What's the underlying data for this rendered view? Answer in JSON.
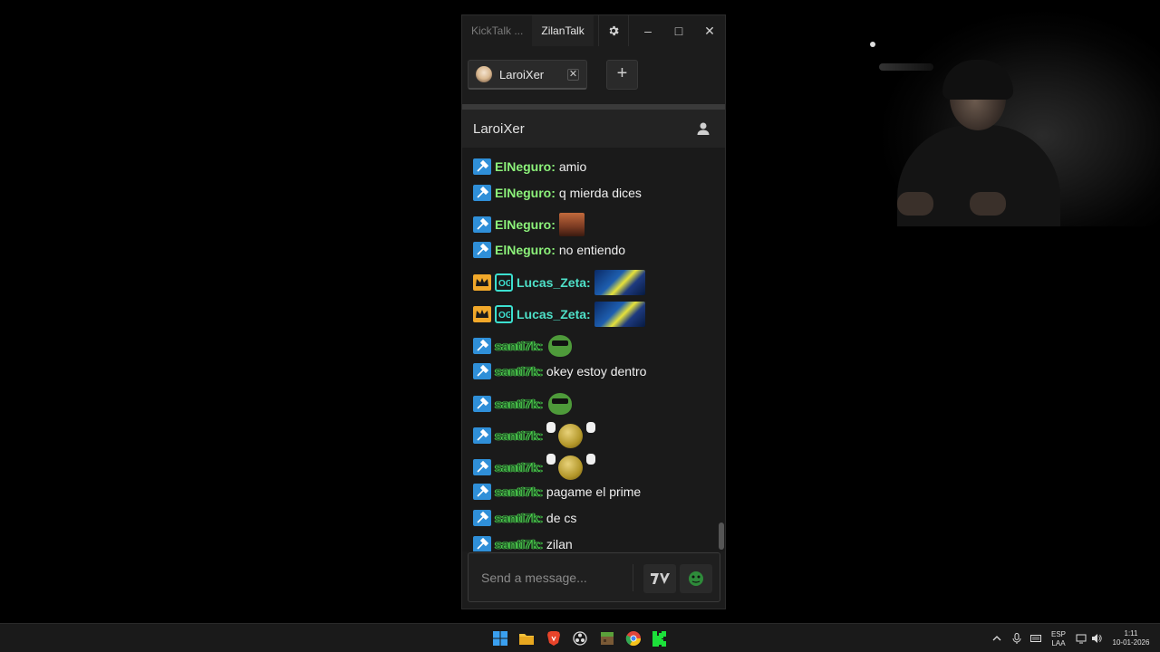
{
  "window": {
    "app_tabs": [
      "KickTalk ...",
      "ZilanTalk"
    ],
    "minimize": "–",
    "maximize": "□",
    "close": "✕"
  },
  "channel_tabs": [
    {
      "name": "LaroiXer",
      "close": "✕"
    }
  ],
  "add_tab": "+",
  "chat": {
    "title": "LaroiXer",
    "messages": [
      {
        "user": "ElNeguro:",
        "text": "amio",
        "badge": "mod-icon",
        "user_style": "green"
      },
      {
        "user": "ElNeguro:",
        "text": "q mierda dices",
        "badge": "mod-icon",
        "user_style": "green"
      },
      {
        "user": "ElNeguro:",
        "text": "",
        "emote": "face-emote",
        "badge": "mod-icon",
        "user_style": "green"
      },
      {
        "user": "ElNeguro:",
        "text": "no entiendo",
        "badge": "mod-icon",
        "user_style": "green"
      },
      {
        "user": "Lucas_Zeta:",
        "text": "",
        "emote": "car-emote",
        "badge": "vip-icon",
        "user_style": "teal"
      },
      {
        "user": "Lucas_Zeta:",
        "text": "",
        "emote": "car-emote",
        "badge": "vip-icon",
        "user_style": "teal"
      },
      {
        "user": "santi7k:",
        "text": "",
        "emote": "pepe-emote",
        "badge": "mod-icon",
        "user_style": "outline"
      },
      {
        "user": "santi7k:",
        "text": "okey estoy dentro",
        "badge": "mod-icon",
        "user_style": "outline"
      },
      {
        "user": "santi7k:",
        "text": "",
        "emote": "pepe-emote",
        "badge": "mod-icon",
        "user_style": "outline"
      },
      {
        "user": "santi7k:",
        "text": "",
        "emote": "coin-emote",
        "badge": "mod-icon",
        "user_style": "outline"
      },
      {
        "user": "santi7k:",
        "text": "",
        "emote": "coin-emote",
        "badge": "mod-icon",
        "user_style": "outline"
      },
      {
        "user": "santi7k:",
        "text": "pagame el prime",
        "badge": "mod-icon",
        "user_style": "outline"
      },
      {
        "user": "santi7k:",
        "text": "de cs",
        "badge": "mod-icon",
        "user_style": "outline"
      },
      {
        "user": "santi7k:",
        "text": "zilan",
        "badge": "mod-icon",
        "user_style": "outline"
      }
    ],
    "input_placeholder": "Send a message..."
  },
  "taskbar": {
    "lang_top": "ESP",
    "lang_bottom": "LAA",
    "time": "1:11",
    "date": "10-01-2026"
  },
  "colors": {
    "mod_badge": "#2f8fd8",
    "vip_badge": "#f1a82a",
    "username_green": "#8cf27a",
    "username_teal": "#4ee0c8"
  }
}
